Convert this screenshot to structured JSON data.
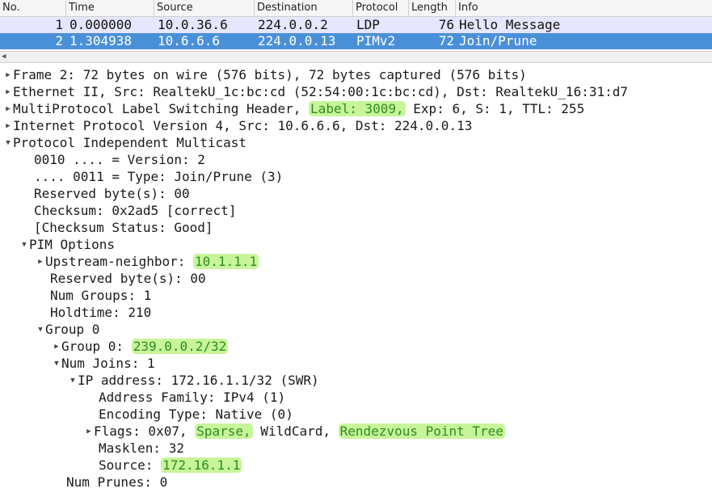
{
  "packet_list": {
    "columns": [
      "No.",
      "Time",
      "Source",
      "Destination",
      "Protocol",
      "Length",
      "Info"
    ],
    "rows": [
      {
        "no": "1",
        "time": "0.000000",
        "source": "10.0.36.6",
        "destination": "224.0.0.2",
        "protocol": "LDP",
        "length": "76",
        "info": "Hello Message"
      },
      {
        "no": "2",
        "time": "1.304938",
        "source": "10.6.6.6",
        "destination": "224.0.0.13",
        "protocol": "PIMv2",
        "length": "72",
        "info": "Join/Prune"
      }
    ]
  },
  "details": {
    "frame": "Frame 2: 72 bytes on wire (576 bits), 72 bytes captured (576 bits)",
    "ethernet": "Ethernet II, Src: RealtekU_1c:bc:cd (52:54:00:1c:bc:cd), Dst: RealtekU_16:31:d7",
    "mpls": {
      "prefix": "MultiProtocol Label Switching Header, ",
      "label": "Label: 3009,",
      "suffix": " Exp: 6, S: 1, TTL: 255"
    },
    "ip": "Internet Protocol Version 4, Src: 10.6.6.6, Dst: 224.0.0.13",
    "pim": {
      "title": "Protocol Independent Multicast",
      "version": "0010 .... = Version: 2",
      "type": ".... 0011 = Type: Join/Prune (3)",
      "reserved": "Reserved byte(s): 00",
      "checksum": "Checksum: 0x2ad5 [correct]",
      "checksum_status": "[Checksum Status: Good]",
      "options": {
        "title": "PIM Options",
        "upstream_prefix": "Upstream-neighbor: ",
        "upstream_value": "10.1.1.1",
        "reserved": "Reserved byte(s): 00",
        "num_groups": "Num Groups: 1",
        "holdtime": "Holdtime: 210",
        "group": {
          "title": "Group 0",
          "group0_prefix": "Group 0: ",
          "group0_value": "239.0.0.2/32",
          "num_joins": "Num Joins: 1",
          "ip_address": "IP address: 172.16.1.1/32 (SWR)",
          "address_family": "Address Family: IPv4 (1)",
          "encoding_type": "Encoding Type: Native (0)",
          "flags_prefix": "Flags: 0x07, ",
          "flags_sparse": "Sparse,",
          "flags_mid": " WildCard, ",
          "flags_rpt": "Rendezvous Point Tree",
          "masklen": "Masklen: 32",
          "source_prefix": "Source: ",
          "source_value": "172.16.1.1",
          "num_prunes": "Num Prunes: 0"
        }
      }
    }
  },
  "colors": {
    "selected_row": "#4a90d9",
    "alt_row": "#e7e6ff",
    "highlight_bg": "#c8f59a",
    "highlight_text": "#2e8b22"
  }
}
